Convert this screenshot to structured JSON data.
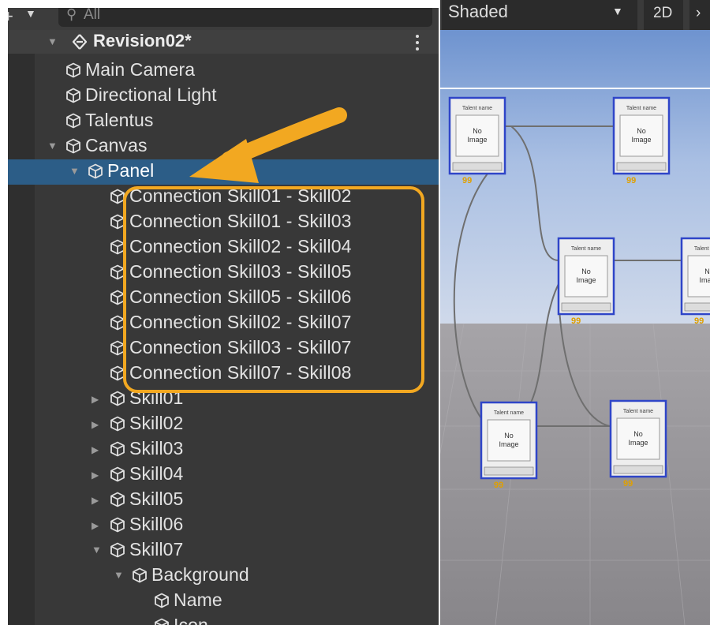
{
  "hierarchy": {
    "toolbar": {
      "add_icon": "plus-icon",
      "search_placeholder": "All",
      "search_icon": "search-icon"
    },
    "scene": {
      "name": "Revision02*",
      "icon": "unity-scene-icon",
      "menu_icon": "kebab-menu-icon"
    },
    "items": [
      {
        "label": "Main Camera",
        "depth": 1,
        "expand": "none"
      },
      {
        "label": "Directional Light",
        "depth": 1,
        "expand": "none"
      },
      {
        "label": "Talentus",
        "depth": 1,
        "expand": "none"
      },
      {
        "label": "Canvas",
        "depth": 1,
        "expand": "open"
      },
      {
        "label": "Panel",
        "depth": 2,
        "expand": "open",
        "selected": true
      },
      {
        "label": "Connection Skill01 - Skill02",
        "depth": 3,
        "expand": "none"
      },
      {
        "label": "Connection Skill01 - Skill03",
        "depth": 3,
        "expand": "none"
      },
      {
        "label": "Connection Skill02 - Skill04",
        "depth": 3,
        "expand": "none"
      },
      {
        "label": "Connection Skill03 - Skill05",
        "depth": 3,
        "expand": "none"
      },
      {
        "label": "Connection Skill05 - Skill06",
        "depth": 3,
        "expand": "none"
      },
      {
        "label": "Connection Skill02 - Skill07",
        "depth": 3,
        "expand": "none"
      },
      {
        "label": "Connection Skill03 - Skill07",
        "depth": 3,
        "expand": "none"
      },
      {
        "label": "Connection Skill07 - Skill08",
        "depth": 3,
        "expand": "none"
      },
      {
        "label": "Skill01",
        "depth": 3,
        "expand": "closed"
      },
      {
        "label": "Skill02",
        "depth": 3,
        "expand": "closed"
      },
      {
        "label": "Skill03",
        "depth": 3,
        "expand": "closed"
      },
      {
        "label": "Skill04",
        "depth": 3,
        "expand": "closed"
      },
      {
        "label": "Skill05",
        "depth": 3,
        "expand": "closed"
      },
      {
        "label": "Skill06",
        "depth": 3,
        "expand": "closed"
      },
      {
        "label": "Skill07",
        "depth": 3,
        "expand": "open"
      },
      {
        "label": "Background",
        "depth": 4,
        "expand": "open"
      },
      {
        "label": "Name",
        "depth": 5,
        "expand": "none"
      },
      {
        "label": "Icon",
        "depth": 5,
        "expand": "none"
      }
    ],
    "annotation": {
      "color": "#f2a821"
    }
  },
  "scene_view": {
    "shading_mode": "Shaded",
    "mode_2d_label": "2D",
    "skill_cards": [
      {
        "title": "Talent name",
        "image_text": "No Image",
        "cost": "99"
      },
      {
        "title": "Talent name",
        "image_text": "No Image",
        "cost": "99"
      },
      {
        "title": "Talent name",
        "image_text": "No Image",
        "cost": "99"
      },
      {
        "title": "Talent name",
        "image_text": "No Image",
        "cost": "99"
      },
      {
        "title": "Talent name",
        "image_text": "No Image",
        "cost": "99"
      },
      {
        "title": "Talent name",
        "image_text": "No Image",
        "cost": "99"
      }
    ]
  },
  "colors": {
    "selection": "#2c5d87",
    "panel_bg": "#383838",
    "card_border": "#2f45c8",
    "cost_text": "#e0a000",
    "annotation": "#f2a821"
  }
}
